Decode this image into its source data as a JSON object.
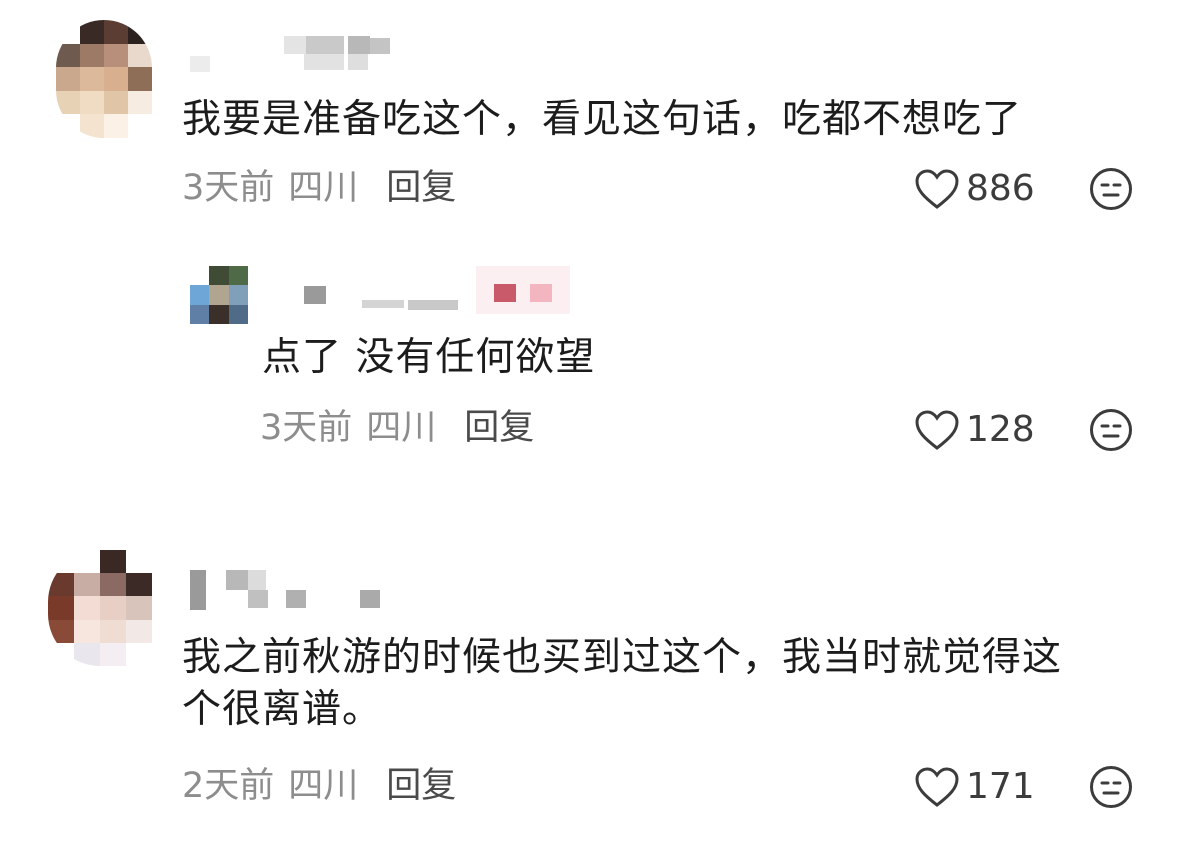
{
  "comments": [
    {
      "text": "我要是准备吃这个，看见这句话，吃都不想吃了",
      "time": "3天前",
      "location": "四川",
      "reply_label": "回复",
      "likes": "886"
    },
    {
      "text": "点了 没有任何欲望",
      "time": "3天前",
      "location": "四川",
      "reply_label": "回复",
      "likes": "128"
    },
    {
      "text_line1": "我之前秋游的时候也买到过这个，我当时就觉得这",
      "text_line2": "个很离谱。",
      "time": "2天前",
      "location": "四川",
      "reply_label": "回复",
      "likes": "171"
    }
  ],
  "icons": {
    "like": "heart-outline-icon",
    "dislike": "unimpressed-face-icon"
  },
  "colors": {
    "text": "#1c1c1c",
    "meta": "#8d8d8d",
    "reply": "#4a4a4a"
  }
}
